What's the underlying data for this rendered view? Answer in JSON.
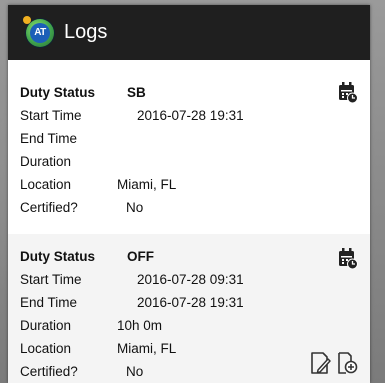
{
  "header": {
    "app_icon": "app-logo-icon",
    "app_icon_text": "AT",
    "title": "Logs"
  },
  "logs": [
    {
      "duty_status_label": "Duty Status",
      "duty_status": "SB",
      "start_time_label": "Start Time",
      "start_time": "2016-07-28 19:31",
      "end_time_label": "End Time",
      "end_time": "",
      "duration_label": "Duration",
      "duration": "",
      "location_label": "Location",
      "location": "Miami, FL",
      "certified_label": "Certified?",
      "certified": "No",
      "action_icon": "calendar-clock-icon"
    },
    {
      "duty_status_label": "Duty Status",
      "duty_status": "OFF",
      "start_time_label": "Start Time",
      "start_time": "2016-07-28 09:31",
      "end_time_label": "End Time",
      "end_time": "2016-07-28 19:31",
      "duration_label": "Duration",
      "duration": "10h 0m",
      "location_label": "Location",
      "location": "Miami, FL",
      "certified_label": "Certified?",
      "certified": "No",
      "action_icon": "calendar-clock-icon",
      "edit_icon": "edit-log-icon",
      "add_icon": "add-log-icon"
    }
  ],
  "colors": {
    "header_bg": "#1f1f1f",
    "card_alt_bg": "#f4f4f4",
    "text": "#111111"
  }
}
